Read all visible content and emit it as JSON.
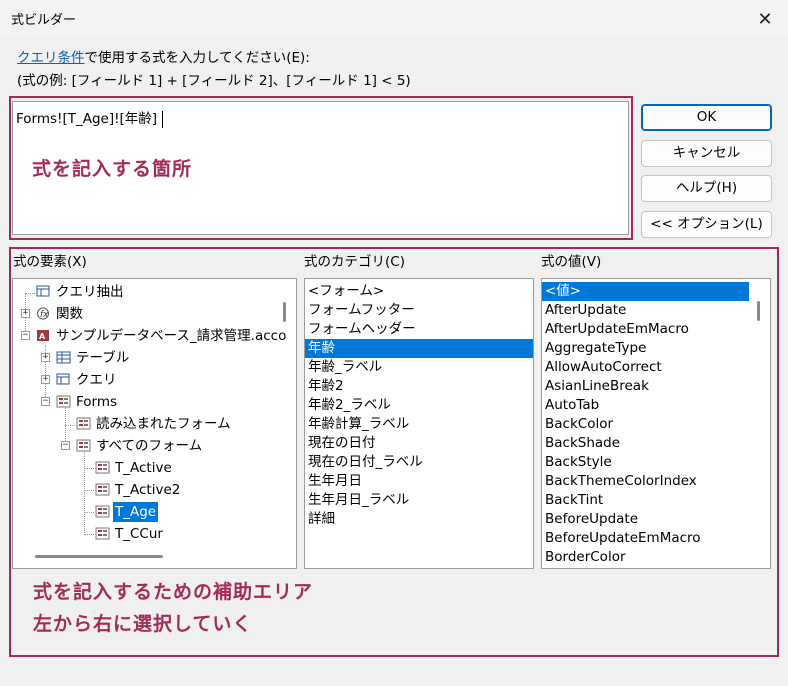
{
  "window": {
    "title": "式ビルダー",
    "close_glyph": "✕"
  },
  "instructions": {
    "link": "クエリ条件",
    "rest": "で使用する式を入力してください(E):",
    "example": "(式の例: [フィールド 1] + [フィールド 2]、[フィールド 1] < 5)"
  },
  "expression": {
    "value": "Forms![T_Age]![年齢]"
  },
  "annotations": {
    "expr_area": "式を記入する箇所",
    "lower_line1": "式を記入するための補助エリア",
    "lower_line2": "左から右に選択していく"
  },
  "buttons": {
    "ok": "OK",
    "cancel": "キャンセル",
    "help": "ヘルプ(H)",
    "options": "<< オプション(L)"
  },
  "columns": {
    "elements": "式の要素(X)",
    "categories": "式のカテゴリ(C)",
    "values": "式の値(V)"
  },
  "tree": {
    "items": [
      {
        "label": "クエリ抽出",
        "icon": "query-icon"
      },
      {
        "label": "関数",
        "icon": "function-icon"
      },
      {
        "label": "サンプルデータベース_請求管理.acco",
        "icon": "access-database-icon"
      },
      {
        "label": "テーブル",
        "icon": "table-icon"
      },
      {
        "label": "クエリ",
        "icon": "query-icon"
      },
      {
        "label": "Forms",
        "icon": "form-icon"
      },
      {
        "label": "読み込まれたフォーム",
        "icon": "form-icon"
      },
      {
        "label": "すべてのフォーム",
        "icon": "form-icon"
      },
      {
        "label": "T_Active",
        "icon": "form-icon"
      },
      {
        "label": "T_Active2",
        "icon": "form-icon"
      },
      {
        "label": "T_Age",
        "icon": "form-icon",
        "selected": true
      },
      {
        "label": "T_CCur",
        "icon": "form-icon"
      }
    ]
  },
  "categories": {
    "items": [
      "<フォーム>",
      "フォームフッター",
      "フォームヘッダー",
      "年齢",
      "年齢_ラベル",
      "年齢2",
      "年齢2_ラベル",
      "年齢計算_ラベル",
      "現在の日付",
      "現在の日付_ラベル",
      "生年月日",
      "生年月日_ラベル",
      "詳細"
    ],
    "selected": "年齢"
  },
  "values": {
    "items": [
      "<値>",
      "AfterUpdate",
      "AfterUpdateEmMacro",
      "AggregateType",
      "AllowAutoCorrect",
      "AsianLineBreak",
      "AutoTab",
      "BackColor",
      "BackShade",
      "BackStyle",
      "BackThemeColorIndex",
      "BackTint",
      "BeforeUpdate",
      "BeforeUpdateEmMacro",
      "BorderColor"
    ],
    "selected": "<値>"
  },
  "colors": {
    "accent_annotation": "#a32a5a",
    "selection": "#0078d7",
    "link": "#0a5fbf"
  }
}
